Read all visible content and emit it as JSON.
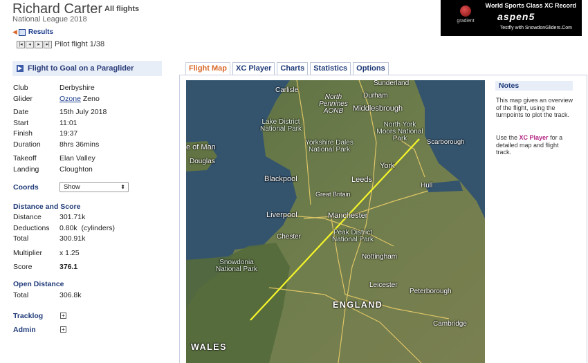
{
  "header": {
    "pilot_name": "Richard Carter",
    "all_flights": "All flights",
    "league": "National League 2018",
    "results_label": "Results",
    "pager_buttons": [
      "|◂",
      "◂",
      "▸",
      "▸|"
    ],
    "pager_label": "Pilot flight 1/38"
  },
  "ad": {
    "title": "World Sports Class XC Record",
    "brand": "aspen5",
    "logo_text": "gradient",
    "subtitle": "Testfly with SnowdonGliders.Com"
  },
  "panel": {
    "title": "Flight to Goal on a Paraglider",
    "club_label": "Club",
    "club": "Derbyshire",
    "glider_label": "Glider",
    "glider_make": "Ozone",
    "glider_model": "Zeno",
    "date_label": "Date",
    "date": "15th July 2018",
    "start_label": "Start",
    "start": "11:01",
    "finish_label": "Finish",
    "finish": "19:37",
    "duration_label": "Duration",
    "duration": "8hrs 36mins",
    "takeoff_label": "Takeoff",
    "takeoff": "Elan Valley",
    "landing_label": "Landing",
    "landing": "Cloughton",
    "coords_label": "Coords",
    "coords_value": "Show",
    "distance_score_heading": "Distance and Score",
    "distance_label": "Distance",
    "distance": "301.71k",
    "deductions_label": "Deductions",
    "deductions": "0.80k  (cylinders)",
    "total_label": "Total",
    "total": "300.91k",
    "multiplier_label": "Multiplier",
    "multiplier": "x 1.25",
    "score_label": "Score",
    "score": "376.1",
    "open_distance_heading": "Open Distance",
    "open_total_label": "Total",
    "open_total": "306.8k",
    "tracklog_label": "Tracklog",
    "admin_label": "Admin",
    "expand_symbol": "+"
  },
  "tabs": [
    {
      "label": "Flight Map",
      "active": true
    },
    {
      "label": "XC Player",
      "active": false
    },
    {
      "label": "Charts",
      "active": false
    },
    {
      "label": "Statistics",
      "active": false
    },
    {
      "label": "Options",
      "active": false
    }
  ],
  "map": {
    "track_color": "#f5f52a",
    "places": [
      {
        "name": "Sunderland"
      },
      {
        "name": "Carlisle"
      },
      {
        "name": "Durham"
      },
      {
        "name": "North Pennines AONB"
      },
      {
        "name": "Middlesbrough"
      },
      {
        "name": "Lake District National Park"
      },
      {
        "name": "North York Moors National Park"
      },
      {
        "name": "Scarborough"
      },
      {
        "name": "e of Man"
      },
      {
        "name": "Douglas"
      },
      {
        "name": "Yorkshire Dales National Park"
      },
      {
        "name": "York"
      },
      {
        "name": "Blackpool"
      },
      {
        "name": "Leeds"
      },
      {
        "name": "Hull"
      },
      {
        "name": "Great Britain"
      },
      {
        "name": "Liverpool"
      },
      {
        "name": "Manchester"
      },
      {
        "name": "Chester"
      },
      {
        "name": "Peak District National Park"
      },
      {
        "name": "Snowdonia National Park"
      },
      {
        "name": "Nottingham"
      },
      {
        "name": "Leicester"
      },
      {
        "name": "Peterborough"
      },
      {
        "name": "ENGLAND"
      },
      {
        "name": "Cambridge"
      },
      {
        "name": "WALES"
      }
    ]
  },
  "notes": {
    "heading": "Notes",
    "p1": "This map gives an overview of the flight, using the turnpoints to plot the track.",
    "p2_before": "Use the ",
    "p2_link": "XC Player",
    "p2_after": " for a detailed map and flight track."
  },
  "colors": {
    "heading_blue": "#1f3a78",
    "active_tab_orange": "#d9682a",
    "panel_bg": "#e8eef8"
  }
}
